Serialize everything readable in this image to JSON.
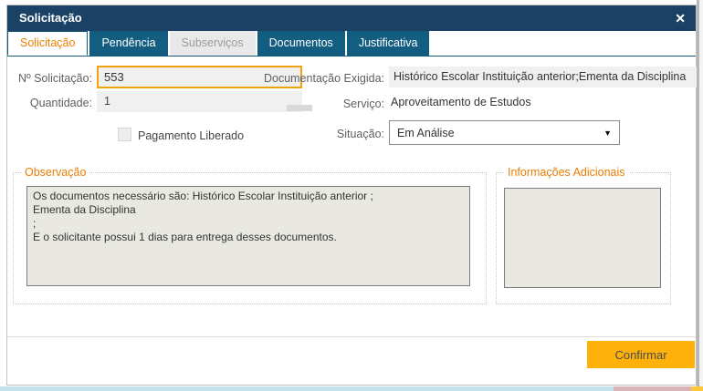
{
  "window": {
    "title": "Solicitação",
    "close_icon": "✕"
  },
  "tabs": [
    {
      "label": "Solicitação",
      "state": "active"
    },
    {
      "label": "Pendência",
      "state": "normal"
    },
    {
      "label": "Subserviços",
      "state": "disabled"
    },
    {
      "label": "Documentos",
      "state": "normal"
    },
    {
      "label": "Justificativa",
      "state": "normal"
    }
  ],
  "form": {
    "numero_solicitacao": {
      "label": "Nº Solicitação:",
      "value": "553"
    },
    "quantidade": {
      "label": "Quantidade:",
      "value": "1"
    },
    "pagamento_liberado": {
      "label": "Pagamento Liberado",
      "checked": false
    },
    "documentacao_exigida": {
      "label": "Documentação Exigida:",
      "value": "Histórico Escolar Instituição anterior;Ementa da Disciplina"
    },
    "servico": {
      "label": "Serviço:",
      "value": "Aproveitamento de Estudos"
    },
    "situacao": {
      "label": "Situação:",
      "value": "Em Análise"
    }
  },
  "observacao": {
    "legend": "Observação",
    "text": "Os documentos necessário são: Histórico Escolar Instituição anterior ;\nEmenta da Disciplina\n;\nE o solicitante possui 1 dias para entrega desses documentos."
  },
  "informacoes_adicionais": {
    "legend": "Informações Adicionais",
    "text": ""
  },
  "footer": {
    "confirm_label": "Confirmar"
  },
  "icons": {
    "dropdown_arrow": "▼"
  },
  "colors": {
    "titlebar": "#1b4265",
    "tab": "#135e80",
    "active_tab_text": "#ee7f00",
    "legend_orange": "#e87e04",
    "confirm_button": "#fdb10a",
    "field_bg": "#f0f0f0",
    "textarea_bg": "#e9e9e2",
    "focus_border": "#f2a20d"
  }
}
